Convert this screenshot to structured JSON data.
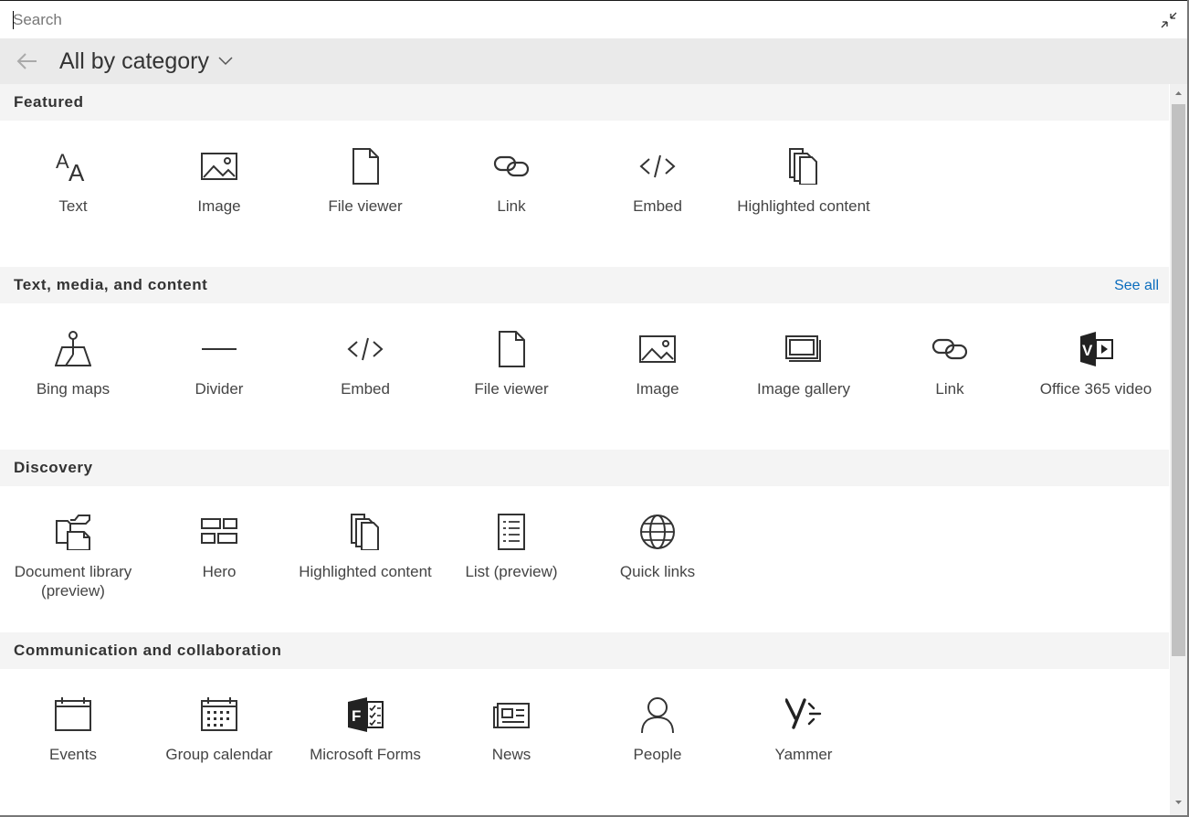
{
  "search": {
    "placeholder": "Search",
    "value": ""
  },
  "header": {
    "category_title": "All by category"
  },
  "sections": [
    {
      "title": "Featured",
      "see_all": "",
      "tiles": [
        {
          "label": "Text",
          "icon": "text-icon"
        },
        {
          "label": "Image",
          "icon": "image-icon"
        },
        {
          "label": "File viewer",
          "icon": "file-icon"
        },
        {
          "label": "Link",
          "icon": "link-icon"
        },
        {
          "label": "Embed",
          "icon": "embed-icon"
        },
        {
          "label": "Highlighted content",
          "icon": "highlighted-content-icon"
        }
      ]
    },
    {
      "title": "Text, media, and content",
      "see_all": "See all",
      "tiles": [
        {
          "label": "Bing maps",
          "icon": "map-pin-icon"
        },
        {
          "label": "Divider",
          "icon": "divider-icon"
        },
        {
          "label": "Embed",
          "icon": "embed-icon"
        },
        {
          "label": "File viewer",
          "icon": "file-icon"
        },
        {
          "label": "Image",
          "icon": "image-icon"
        },
        {
          "label": "Image gallery",
          "icon": "image-gallery-icon"
        },
        {
          "label": "Link",
          "icon": "link-icon"
        },
        {
          "label": "Office 365 video",
          "icon": "office-video-icon"
        }
      ]
    },
    {
      "title": "Discovery",
      "see_all": "",
      "tiles": [
        {
          "label": "Document library (preview)",
          "icon": "document-library-icon"
        },
        {
          "label": "Hero",
          "icon": "hero-icon"
        },
        {
          "label": "Highlighted content",
          "icon": "highlighted-content-icon"
        },
        {
          "label": "List (preview)",
          "icon": "list-icon"
        },
        {
          "label": "Quick links",
          "icon": "globe-icon"
        }
      ]
    },
    {
      "title": "Communication and collaboration",
      "see_all": "",
      "tiles": [
        {
          "label": "Events",
          "icon": "calendar-icon"
        },
        {
          "label": "Group calendar",
          "icon": "group-calendar-icon"
        },
        {
          "label": "Microsoft Forms",
          "icon": "forms-icon"
        },
        {
          "label": "News",
          "icon": "news-icon"
        },
        {
          "label": "People",
          "icon": "person-icon"
        },
        {
          "label": "Yammer",
          "icon": "yammer-icon"
        }
      ]
    }
  ],
  "colors": {
    "accent": "#0a6cbd",
    "header_bg": "#eaeaea",
    "section_bg": "#f4f4f4"
  }
}
